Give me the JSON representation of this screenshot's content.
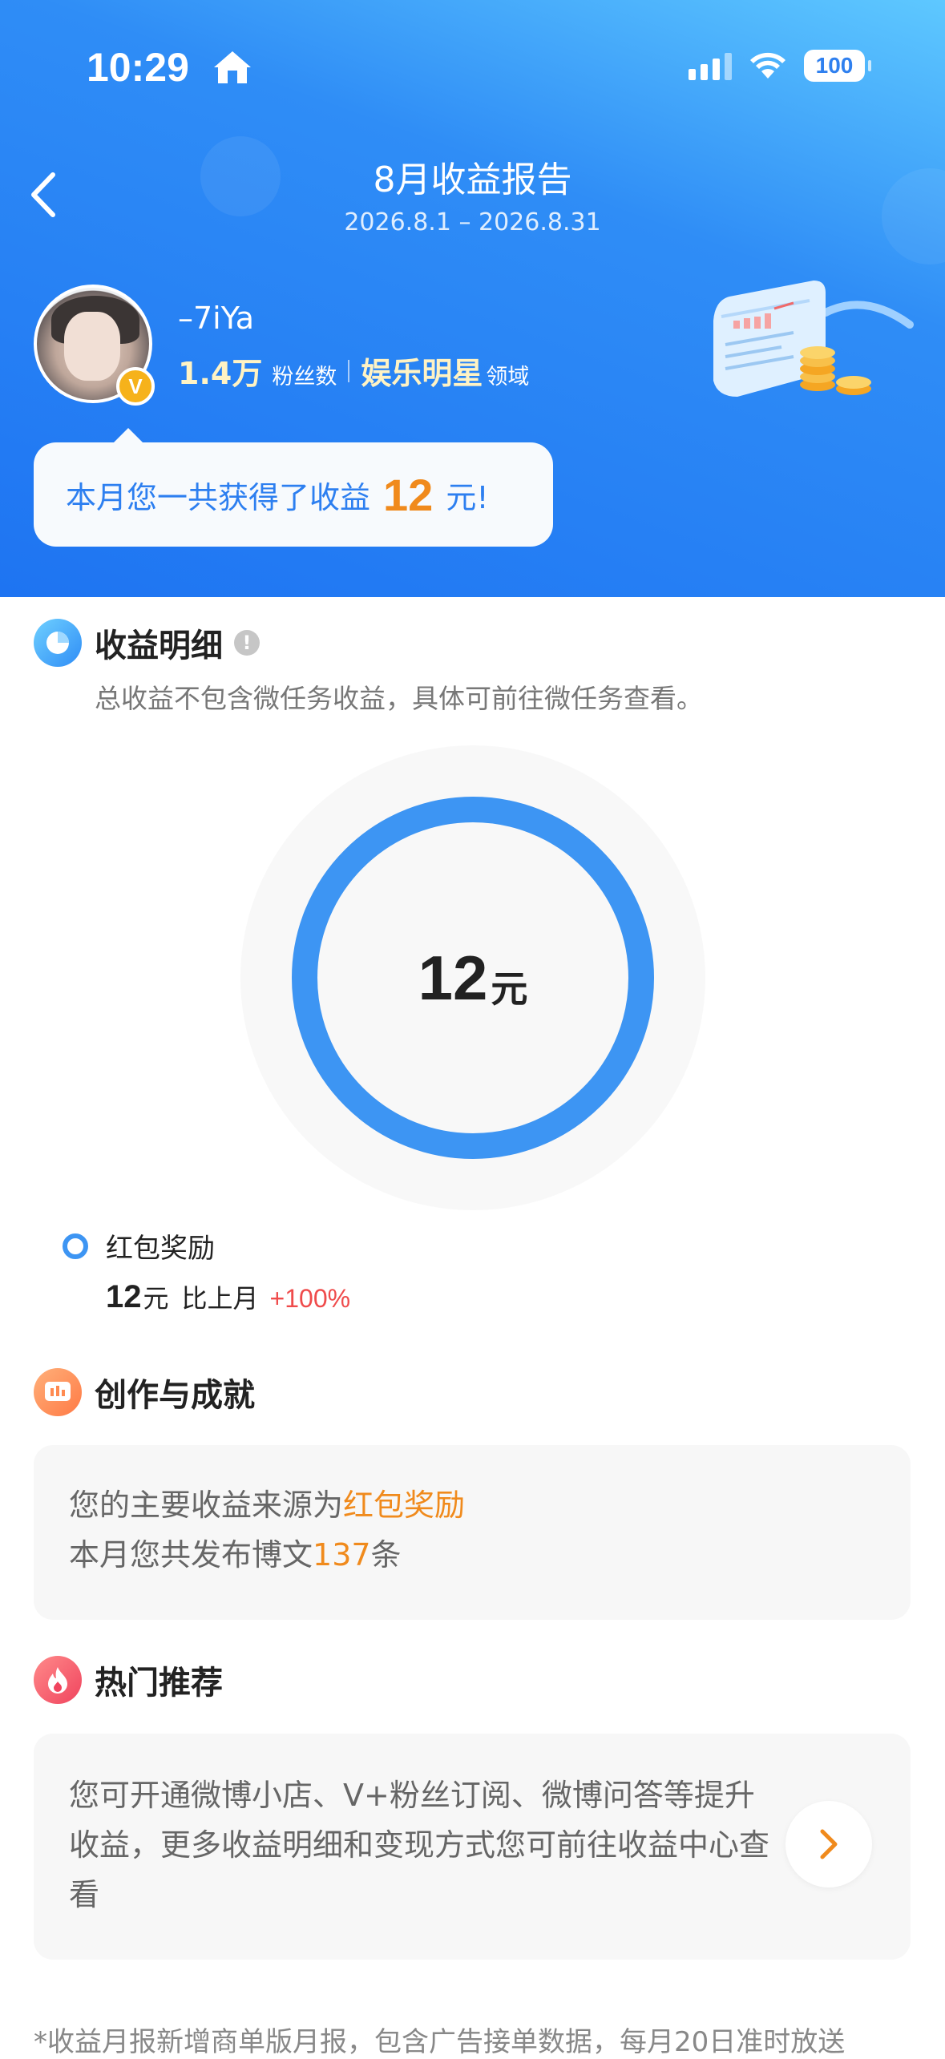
{
  "status_bar": {
    "time": "10:29",
    "battery": "100"
  },
  "header": {
    "title": "8月收益报告",
    "date_range": "2026.8.1 – 2026.8.31"
  },
  "profile": {
    "username": "–7iYa",
    "badge": "V",
    "fans_count": "1.4万",
    "fans_label": "粉丝数",
    "domain": "娱乐明星",
    "domain_label": "领域"
  },
  "earnings_banner": {
    "prefix": "本月您一共获得了收益",
    "amount": "12",
    "suffix": "元!"
  },
  "income_detail": {
    "title": "收益明细",
    "info_icon": "!",
    "description": "总收益不包含微任务收益，具体可前往微任务查看。",
    "total_value": "12",
    "total_unit": "元",
    "items": [
      {
        "label": "红包奖励",
        "value": "12",
        "unit": "元",
        "compare_label": "比上月",
        "change": "+100%",
        "share": 1.0
      }
    ],
    "colors": {
      "ring": "#3d95f3",
      "track": "#f8f8f8"
    }
  },
  "achievement": {
    "title": "创作与成就",
    "line1_prefix": "您的主要收益来源为",
    "line1_highlight": "红包奖励",
    "line2_prefix": "本月您共发布博文",
    "line2_count": "137",
    "line2_suffix": "条"
  },
  "hot_recommend": {
    "title": "热门推荐",
    "text": "您可开通微博小店、V+粉丝订阅、微博问答等提升收益，更多收益明细和变现方式您可前往收益中心查看"
  },
  "footnote": "*收益月报新增商单版月报，包含广告接单数据，每月20日准时放送"
}
